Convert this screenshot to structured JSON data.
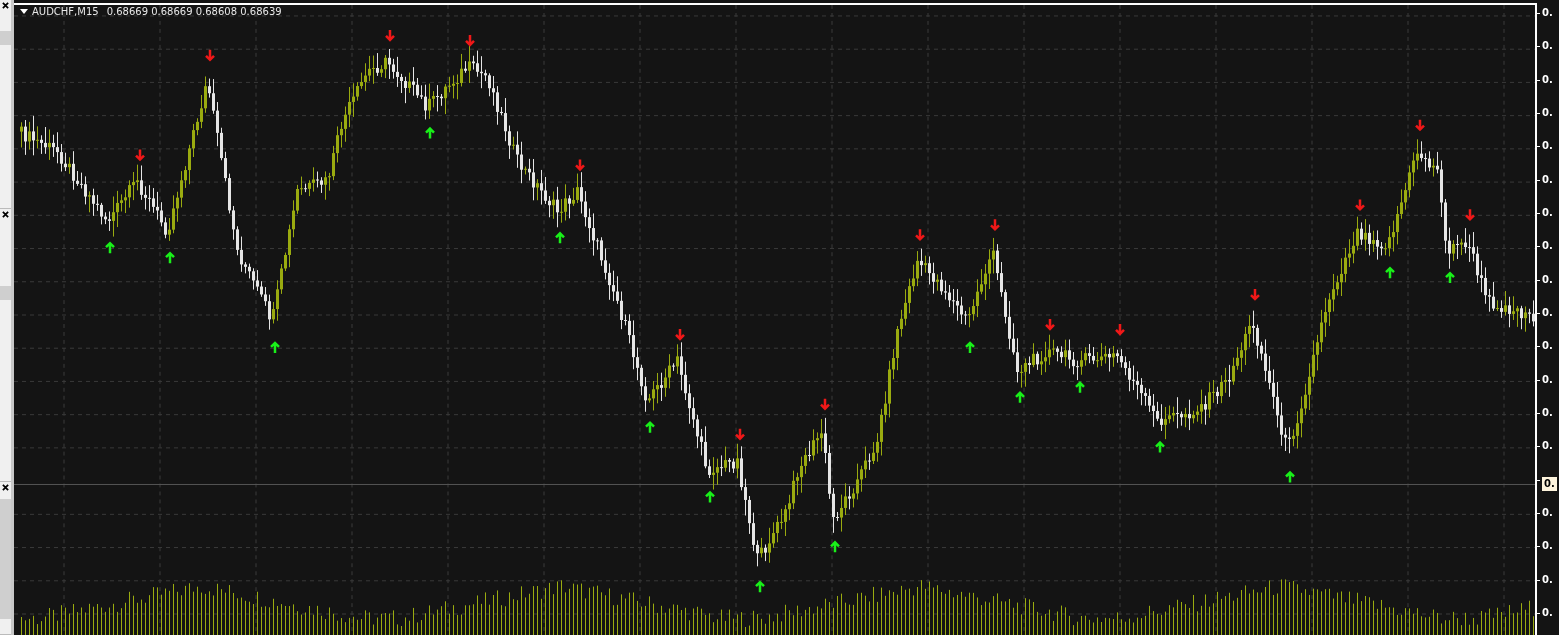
{
  "chart": {
    "symbol": "AUDCHF,M15",
    "ohlc": [
      "0.68669",
      "0.68669",
      "0.68608",
      "0.68639"
    ]
  },
  "price_axis": [
    {
      "text": "0.",
      "kind": "tick"
    },
    {
      "text": "0.",
      "kind": "tick"
    },
    {
      "text": "0.",
      "kind": "tick"
    },
    {
      "text": "0.",
      "kind": "tick"
    },
    {
      "text": "0.",
      "kind": "tick"
    },
    {
      "text": "0.",
      "kind": "tick"
    },
    {
      "text": "0.",
      "kind": "tick"
    },
    {
      "text": "0.",
      "kind": "tick"
    },
    {
      "text": "0.",
      "kind": "tick"
    },
    {
      "text": "0.",
      "kind": "tick"
    },
    {
      "text": "0.",
      "kind": "tick"
    },
    {
      "text": "0.",
      "kind": "tick"
    },
    {
      "text": "0.",
      "kind": "tick"
    },
    {
      "text": "0.",
      "kind": "tick"
    },
    {
      "text": "0.",
      "kind": "price"
    },
    {
      "text": "0.",
      "kind": "tick"
    },
    {
      "text": "0.",
      "kind": "tick"
    },
    {
      "text": "0.",
      "kind": "tick"
    },
    {
      "text": "0.",
      "kind": "tick"
    }
  ]
}
